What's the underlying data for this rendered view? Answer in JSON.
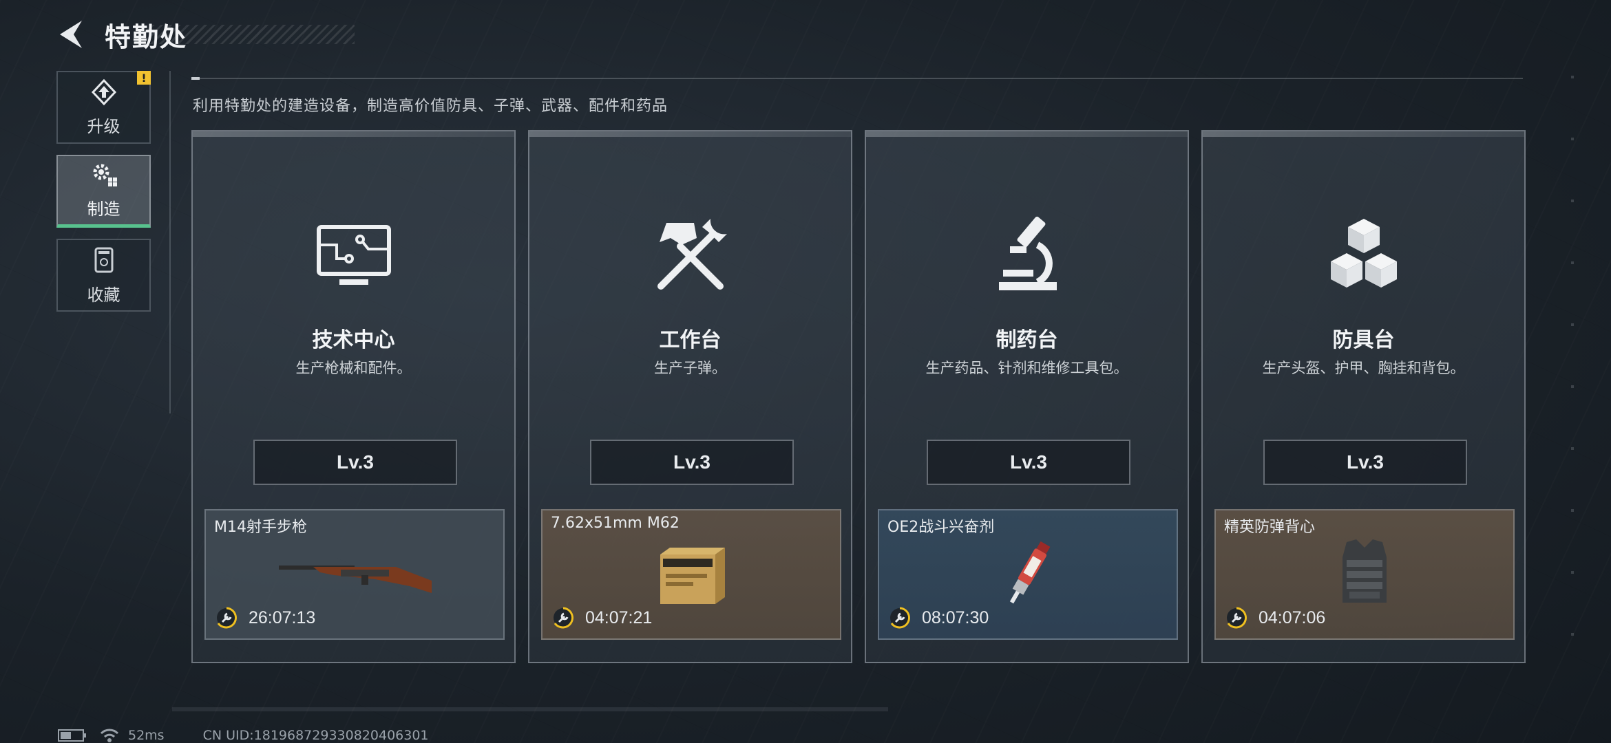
{
  "header": {
    "title": "特勤处"
  },
  "sidebar": {
    "items": [
      {
        "label": "升级",
        "icon": "upgrade-icon",
        "active": false,
        "alert": "!"
      },
      {
        "label": "制造",
        "icon": "gear-cluster-icon",
        "active": true
      },
      {
        "label": "收藏",
        "icon": "collection-icon",
        "active": false
      }
    ]
  },
  "description": "利用特勤处的建造设备，制造高价值防具、子弹、武器、配件和药品",
  "cards": [
    {
      "title": "技术中心",
      "subtitle": "生产枪械和配件。",
      "icon": "computer-monitor-icon",
      "level": "Lv.3",
      "product": {
        "name": "M14射手步枪",
        "timer": "26:07:13",
        "style": "gray",
        "image": "rifle-image"
      }
    },
    {
      "title": "工作台",
      "subtitle": "生产子弹。",
      "icon": "hammer-wrench-icon",
      "level": "Lv.3",
      "product": {
        "name": "7.62x51mm M62",
        "timer": "04:07:21",
        "style": "brown",
        "image": "ammo-box-image"
      }
    },
    {
      "title": "制药台",
      "subtitle": "生产药品、针剂和维修工具包。",
      "icon": "microscope-icon",
      "level": "Lv.3",
      "product": {
        "name": "OE2战斗兴奋剂",
        "timer": "08:07:30",
        "style": "blue",
        "image": "stim-injector-image"
      }
    },
    {
      "title": "防具台",
      "subtitle": "生产头盔、护甲、胸挂和背包。",
      "icon": "cubes-icon",
      "level": "Lv.3",
      "product": {
        "name": "精英防弹背心",
        "timer": "04:07:06",
        "style": "brown",
        "image": "armor-vest-image"
      }
    }
  ],
  "status_bar": {
    "ping": "52ms",
    "uid": "CN UID:18196872933082040630​1"
  },
  "colors": {
    "accent_green": "#58c28e",
    "alert_yellow": "#f2c230",
    "timer_yellow": "#f0c020"
  }
}
